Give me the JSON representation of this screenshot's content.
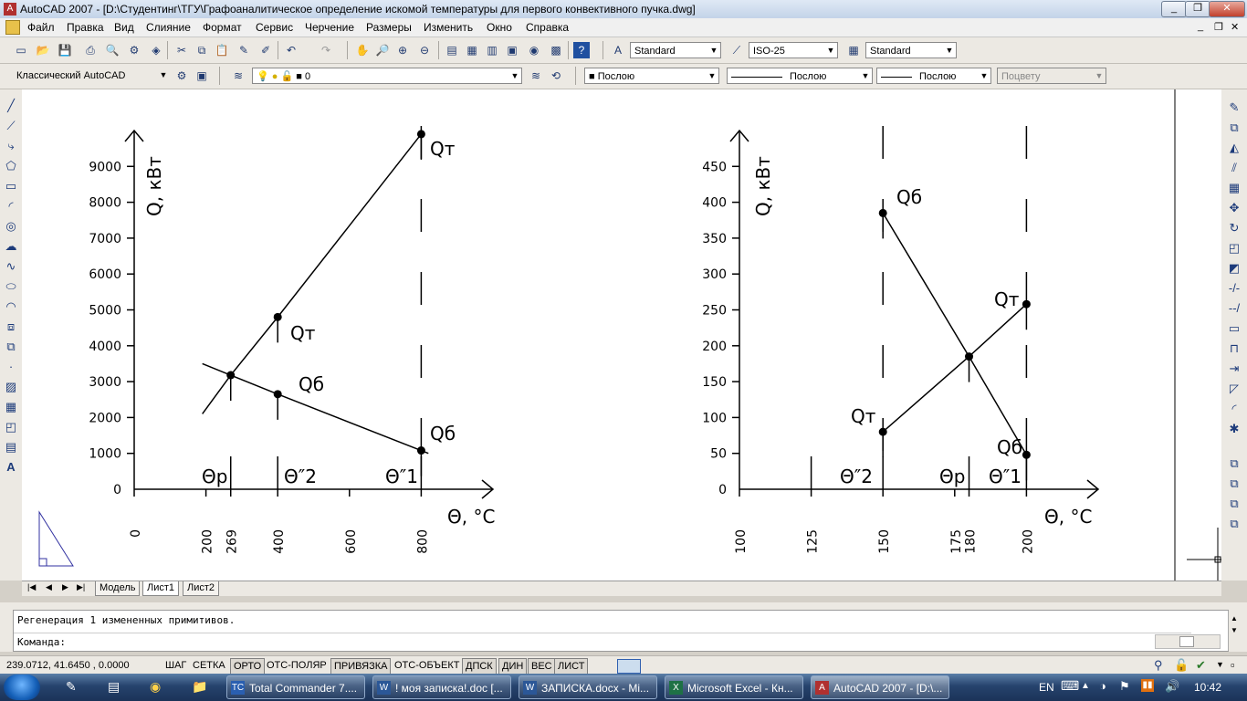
{
  "window": {
    "title": "AutoCAD 2007 - [D:\\Студентинг\\ТГУ\\Графоаналитическое определение искомой температуры для первого конвективного пучка.dwg]",
    "controls": {
      "minimize": "_",
      "restore": "❐",
      "close": "✕"
    },
    "doc_controls": {
      "minimize": "_",
      "restore": "❐",
      "close": "✕"
    }
  },
  "menu": {
    "items": [
      "Файл",
      "Правка",
      "Вид",
      "Слияние",
      "Формат",
      "Сервис",
      "Черчение",
      "Размеры",
      "Изменить",
      "Окно",
      "Справка"
    ]
  },
  "toolbar1": {
    "text_style": "Standard",
    "dim_style": "ISO-25",
    "table_style": "Standard"
  },
  "toolbar2": {
    "workspace": "Классический AutoCAD",
    "layer": "0",
    "color": "Послою",
    "linetype": "Послою",
    "lineweight": "Послою",
    "plotstyle": "Поцвету"
  },
  "tabs": {
    "items": [
      "Модель",
      "Лист1",
      "Лист2"
    ],
    "active": "Лист1"
  },
  "command": {
    "history": "Регенерация 1 измененных примитивов.",
    "prompt": "Команда:"
  },
  "status": {
    "coords": "239.0712, 41.6450 , 0.0000",
    "buttons": [
      "ШАГ",
      "СЕТКА",
      "ОРТО",
      "ОТС-ПОЛЯР",
      "ПРИВЯЗКА",
      "ОТС-ОБЪЕКТ",
      "ДПСК",
      "ДИН",
      "ВЕС",
      "ЛИСТ"
    ]
  },
  "taskbar": {
    "tasks": [
      {
        "label": "Total Commander 7....",
        "icon": "TC"
      },
      {
        "label": "! моя записка!.doc [...",
        "icon": "W"
      },
      {
        "label": "ЗАПИСКА.docx - Mi...",
        "icon": "W"
      },
      {
        "label": "Microsoft Excel - Кн...",
        "icon": "X"
      },
      {
        "label": "AutoCAD 2007 - [D:\\...",
        "icon": "A"
      }
    ],
    "lang": "EN",
    "time": "10:42"
  },
  "chart_data": [
    {
      "type": "line",
      "xlabel": "Θ, °С",
      "ylabel": "Q, кВт",
      "x_ticks": [
        "0",
        "200",
        "269",
        "400",
        "600",
        "800"
      ],
      "y_ticks": [
        "1000",
        "2000",
        "3000",
        "4000",
        "5000",
        "6000",
        "7000",
        "8000",
        "9000"
      ],
      "series": [
        {
          "name": "Qт",
          "points": [
            [
              269,
              3180
            ],
            [
              400,
              4800
            ],
            [
              800,
              9900
            ]
          ]
        },
        {
          "name": "Qб",
          "points": [
            [
              269,
              3180
            ],
            [
              400,
              2650
            ],
            [
              800,
              1080
            ]
          ]
        }
      ],
      "annotations": [
        "Θр",
        "Θ″2",
        "Θ″1"
      ]
    },
    {
      "type": "line",
      "xlabel": "Θ, °С",
      "ylabel": "Q, кВт",
      "x_ticks": [
        "100",
        "125",
        "150",
        "175",
        "180",
        "200"
      ],
      "y_ticks": [
        "50",
        "100",
        "150",
        "200",
        "250",
        "300",
        "350",
        "400",
        "450"
      ],
      "series": [
        {
          "name": "Qт",
          "points": [
            [
              150,
              80
            ],
            [
              180,
              185
            ],
            [
              200,
              258
            ]
          ]
        },
        {
          "name": "Qб",
          "points": [
            [
              150,
              385
            ],
            [
              180,
              185
            ],
            [
              200,
              48
            ]
          ]
        }
      ],
      "annotations": [
        "Θ″2",
        "Θр",
        "Θ″1"
      ]
    }
  ]
}
